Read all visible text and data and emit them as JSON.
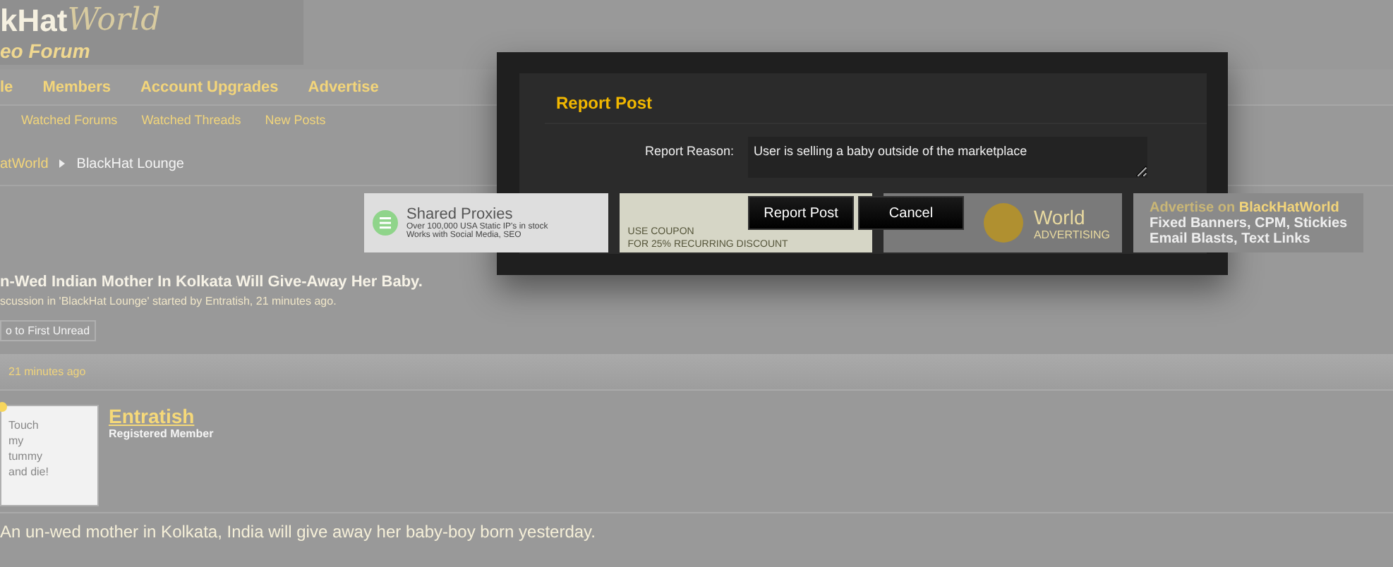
{
  "logo": {
    "brand": "kHat",
    "script": "World",
    "tagline": "eo Forum"
  },
  "nav": [
    "le",
    "Members",
    "Account Upgrades",
    "Advertise"
  ],
  "subnav": [
    "Watched Forums",
    "Watched Threads",
    "New Posts"
  ],
  "breadcrumb": [
    "atWorld",
    "BlackHat Lounge"
  ],
  "ads": [
    {
      "kind": "proxies",
      "title": "Shared Proxies",
      "lines": [
        "Over 100,000 USA Static IP's in stock",
        "Works with Social Media, SEO"
      ]
    },
    {
      "kind": "coupon",
      "lines": [
        "USE COUPON",
        "FOR 25% RECURRING DISCOUNT"
      ]
    },
    {
      "kind": "logo",
      "lines": [
        "World",
        "ADVERTISING"
      ]
    },
    {
      "kind": "text",
      "title": "Advertise on ",
      "highlight": "BlackHatWorld",
      "lines": [
        "Fixed Banners, CPM, Stickies",
        "Email Blasts, Text Links"
      ]
    }
  ],
  "thread": {
    "title": "n-Wed Indian Mother In Kolkata Will Give-Away Her Baby.",
    "meta": "scussion in 'BlackHat Lounge' started by Entratish, 21 minutes ago.",
    "unread_button": "o to First Unread"
  },
  "post": {
    "time": "21 minutes ago",
    "author": "Entratish",
    "role": "Registered Member",
    "avatar_lines": [
      "Touch",
      "my",
      "tummy",
      "and die!"
    ],
    "body": "An un-wed mother in Kolkata, India will give away her baby-boy born yesterday."
  },
  "modal": {
    "title": "Report Post",
    "label": "Report Reason:",
    "value": "User is selling a baby outside of the marketplace",
    "buttons": [
      "Report Post",
      "Cancel"
    ]
  }
}
